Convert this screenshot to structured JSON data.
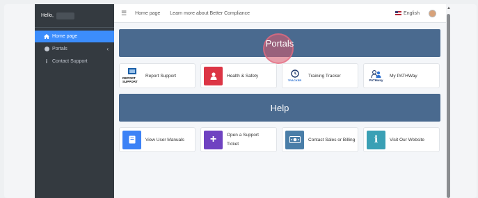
{
  "sidebar": {
    "greeting": "Hello,",
    "items": [
      {
        "label": "Home page",
        "icon": "home-icon",
        "active": true
      },
      {
        "label": "Portals",
        "icon": "circle-icon",
        "chevron": "‹"
      },
      {
        "label": "Contact Support",
        "icon": "info-icon"
      }
    ]
  },
  "topbar": {
    "links": [
      "Home page",
      "Learn more about Better Compliance"
    ],
    "language": "English"
  },
  "sections": {
    "portals_title": "Portals",
    "help_title": "Help"
  },
  "portal_cards": [
    {
      "label": "Report Support",
      "icon": "report-support-logo",
      "logo_text": "REPORT SUPPORT"
    },
    {
      "label": "Health & Safety",
      "icon": "health-safety-icon",
      "color": "#dc3545"
    },
    {
      "label": "Training Tracker",
      "icon": "training-tracker-logo",
      "logo_text": "TRACKER"
    },
    {
      "label": "My PATHWay",
      "icon": "pathway-logo",
      "logo_text": "PATHway"
    }
  ],
  "help_cards": [
    {
      "label": "View User Manuals",
      "icon": "book-icon",
      "color": "#3c82f6"
    },
    {
      "label_line1": "Open a Support",
      "label_line2": "Ticket",
      "icon": "plus-icon",
      "color": "#6f42c1"
    },
    {
      "label": "Contact Sales or Billing",
      "icon": "money-icon",
      "color": "#4a7ea8"
    },
    {
      "label": "Visit Our Website",
      "icon": "info-icon",
      "color": "#3aa0b5"
    }
  ]
}
